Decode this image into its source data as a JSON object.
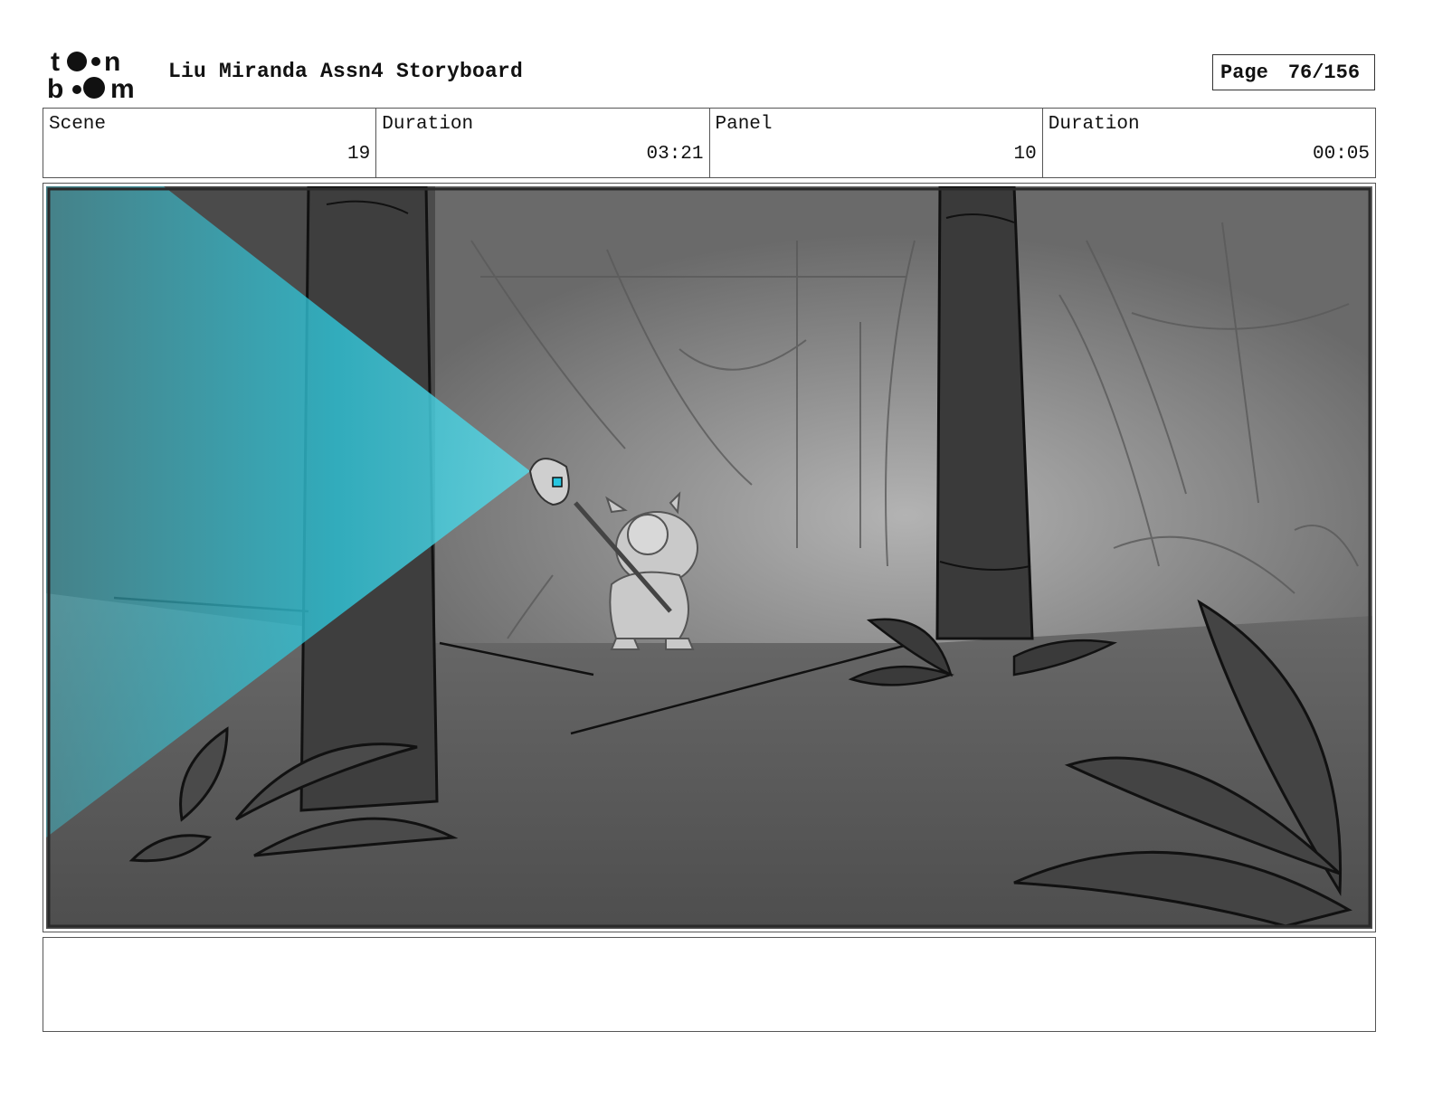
{
  "header": {
    "logo_text": "toon boom",
    "title": "Liu Miranda Assn4 Storyboard",
    "page_label": "Page",
    "page_value": "76/156"
  },
  "info": {
    "scene_label": "Scene",
    "scene_value": "19",
    "scene_duration_label": "Duration",
    "scene_duration_value": "03:21",
    "panel_label": "Panel",
    "panel_value": "10",
    "panel_duration_label": "Duration",
    "panel_duration_value": "00:05"
  },
  "panel": {
    "image_kind": "storyboard-sketch",
    "colors": {
      "background": "#4a4a4a",
      "ground": "#5a5a5a",
      "clearing": "#9a9a9a",
      "light_beam": "#3fd0e0",
      "gem": "#27c6e0"
    }
  },
  "notes": {
    "text": ""
  }
}
